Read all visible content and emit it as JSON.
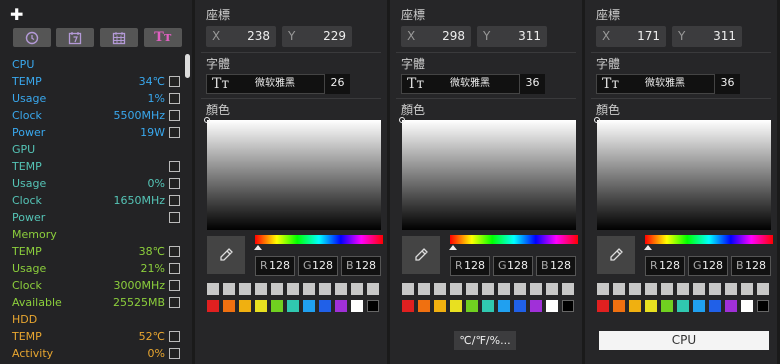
{
  "left_panel": {
    "add_symbol": "✚",
    "tools": [
      "clock-icon",
      "calendar-7-icon",
      "calendar-grid-icon",
      "text-tool-icon"
    ],
    "tool_text": "Tт",
    "sensors": [
      {
        "label": "CPU",
        "value": "",
        "checkbox": false,
        "color": "#39a8ee"
      },
      {
        "label": "TEMP",
        "value": "34℃",
        "checkbox": true,
        "color": "#39a8ee"
      },
      {
        "label": "Usage",
        "value": "1%",
        "checkbox": true,
        "color": "#39a8ee"
      },
      {
        "label": "Clock",
        "value": "5500MHz",
        "checkbox": true,
        "color": "#39a8ee"
      },
      {
        "label": "Power",
        "value": "19W",
        "checkbox": true,
        "color": "#39a8ee"
      },
      {
        "label": "GPU",
        "value": "",
        "checkbox": false,
        "color": "#55c4b6"
      },
      {
        "label": "TEMP",
        "value": "",
        "checkbox": true,
        "color": "#55c4b6"
      },
      {
        "label": "Usage",
        "value": "0%",
        "checkbox": true,
        "color": "#55c4b6"
      },
      {
        "label": "Clock",
        "value": "1650MHz",
        "checkbox": true,
        "color": "#55c4b6"
      },
      {
        "label": "Power",
        "value": "",
        "checkbox": true,
        "color": "#55c4b6"
      },
      {
        "label": "Memory",
        "value": "",
        "checkbox": false,
        "color": "#8ccf3c"
      },
      {
        "label": "TEMP",
        "value": "38℃",
        "checkbox": true,
        "color": "#8ccf3c"
      },
      {
        "label": "Usage",
        "value": "21%",
        "checkbox": true,
        "color": "#8ccf3c"
      },
      {
        "label": "Clock",
        "value": "3000MHz",
        "checkbox": true,
        "color": "#8ccf3c"
      },
      {
        "label": "Available",
        "value": "25525MB",
        "checkbox": true,
        "color": "#8ccf3c"
      },
      {
        "label": "HDD",
        "value": "",
        "checkbox": false,
        "color": "#e8a630"
      },
      {
        "label": "TEMP",
        "value": "52℃",
        "checkbox": true,
        "color": "#e8a630"
      },
      {
        "label": "Activity",
        "value": "0%",
        "checkbox": true,
        "color": "#e8a630"
      }
    ]
  },
  "labels": {
    "position": "座標",
    "font": "字體",
    "color": "顏色",
    "x": "X",
    "y": "Y",
    "r": "R",
    "g": "G",
    "b": "B"
  },
  "panels": [
    {
      "x": "238",
      "y": "229",
      "font_name": "微软雅黑",
      "font_size": "26",
      "r": "128",
      "g": "128",
      "b": "128",
      "bottom_button": ""
    },
    {
      "x": "298",
      "y": "311",
      "font_name": "微软雅黑",
      "font_size": "36",
      "r": "128",
      "g": "128",
      "b": "128",
      "bottom_button": "℃/℉/%..."
    },
    {
      "x": "171",
      "y": "311",
      "font_name": "微软雅黑",
      "font_size": "36",
      "r": "128",
      "g": "128",
      "b": "128",
      "bottom_button": "CPU"
    }
  ],
  "swatch_colors": {
    "grey_row": [
      "#c8c8c8",
      "#c8c8c8",
      "#c8c8c8",
      "#c8c8c8",
      "#c8c8c8",
      "#c8c8c8",
      "#c8c8c8",
      "#c8c8c8",
      "#c8c8c8",
      "#c8c8c8",
      "#c8c8c8"
    ],
    "color_row": [
      "#e02020",
      "#f07010",
      "#f0b010",
      "#e8e020",
      "#70d020",
      "#30c8b0",
      "#20a0f0",
      "#2060e8",
      "#a030d8",
      "#ffffff",
      "#000000"
    ]
  },
  "font_icon_text": "Tт"
}
